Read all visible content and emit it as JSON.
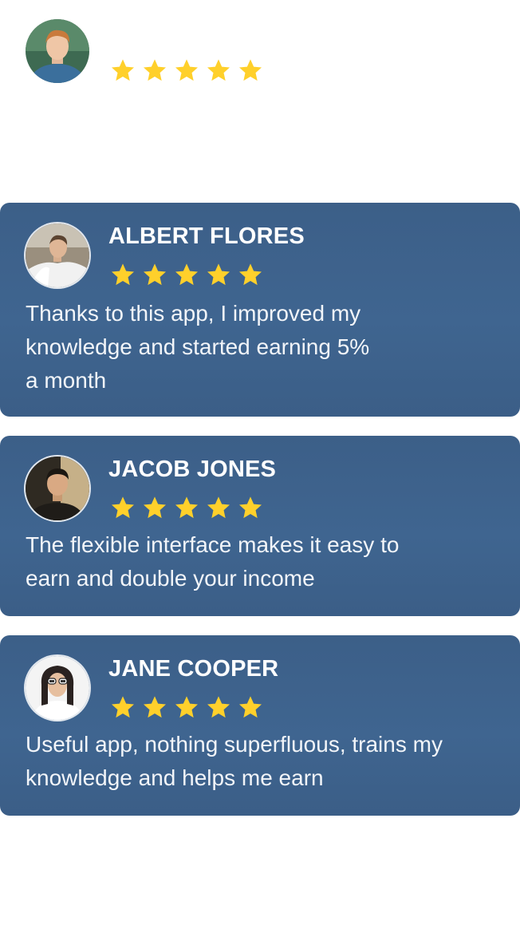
{
  "top_review": {
    "avatar_icon": "person-avatar-icon",
    "rating": 5
  },
  "reviews": [
    {
      "name": "ALBERT FLORES",
      "rating": 5,
      "text": "Thanks to this app, I improved my\nknowledge and started earning 5%\na month",
      "avatar_icon": "person-avatar-icon"
    },
    {
      "name": "JACOB JONES",
      "rating": 5,
      "text": "The flexible interface makes it easy to\nearn and double your income",
      "avatar_icon": "person-avatar-icon"
    },
    {
      "name": "JANE COOPER",
      "rating": 5,
      "text": "Useful app, nothing superfluous, trains my\nknowledge and helps me earn",
      "avatar_icon": "person-avatar-icon"
    }
  ],
  "colors": {
    "card_bg": "#3f6590",
    "star": "#ffd02b",
    "text": "#ffffff"
  }
}
